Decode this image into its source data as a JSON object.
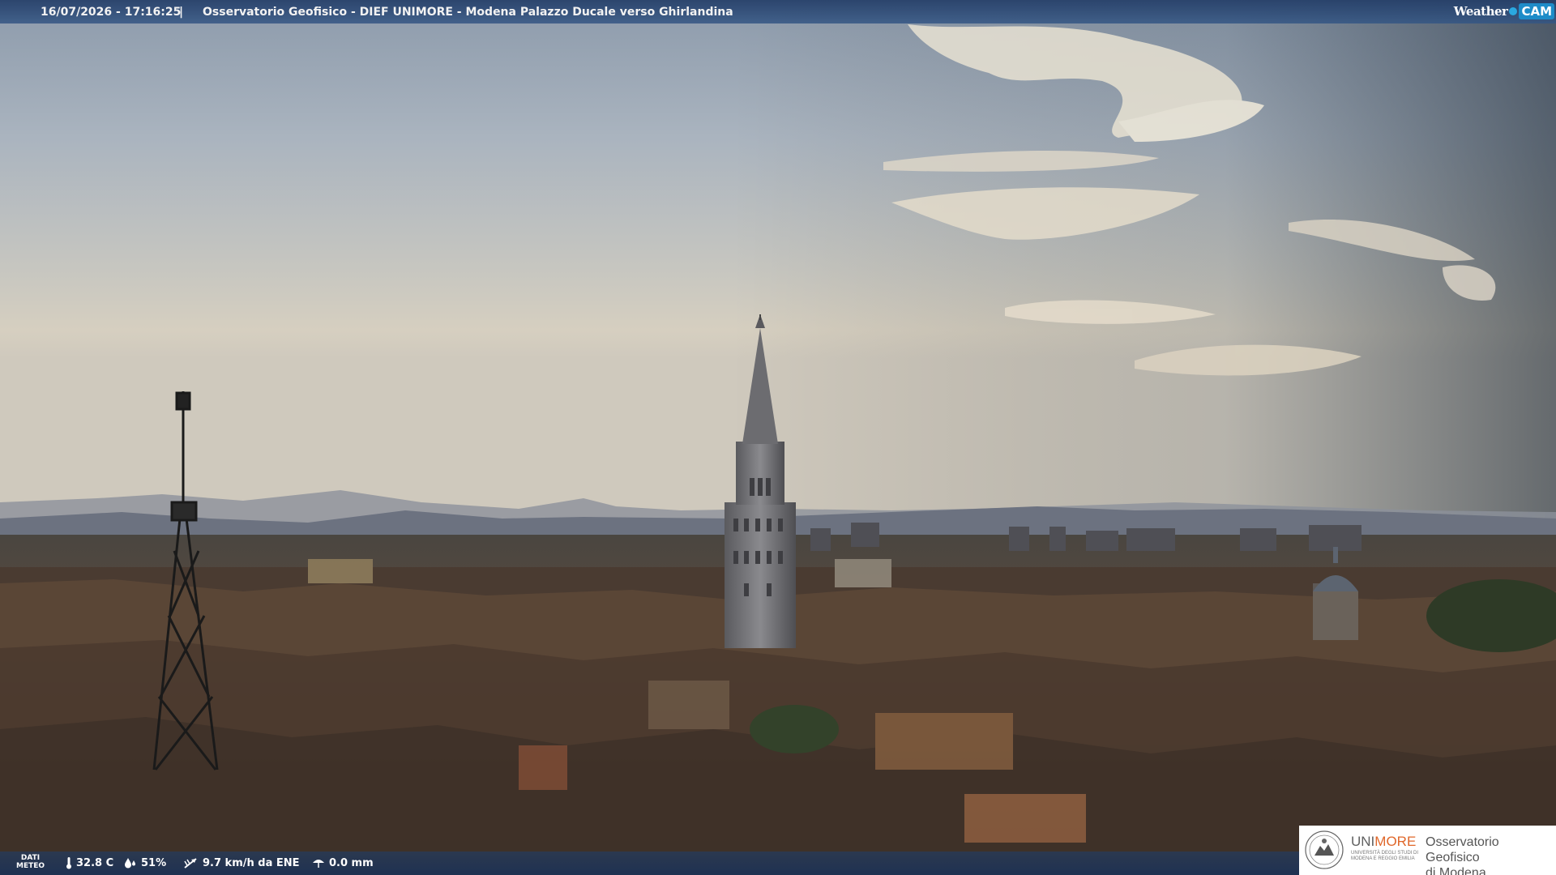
{
  "overlay": {
    "datetime": "16/07/2026 - 17:16:25",
    "separator": "|",
    "title": "Osservatorio Geofisico - DIEF UNIMORE - Modena Palazzo Ducale verso Ghirlandina",
    "brand_weather": "Weather",
    "brand_cam": "CAM"
  },
  "weather": {
    "label_line1": "DATI",
    "label_line2": "METEO",
    "temperature": "32.8 C",
    "humidity": "51%",
    "wind": "9.7 km/h da ENE",
    "rain": "0.0 mm"
  },
  "badge": {
    "uni_part1": "UNI",
    "uni_part2": "MORE",
    "uni_sub1": "UNIVERSITÀ DEGLI STUDI DI",
    "uni_sub2": "MODENA E REGGIO EMILIA",
    "obs_line1": "Osservatorio Geofisico",
    "obs_line2": "di Modena"
  },
  "colors": {
    "topbar": "#2e5186",
    "bottombar": "#1c4070",
    "unimore_accent": "#e0672a",
    "cam_blue": "#1e8cc8"
  }
}
